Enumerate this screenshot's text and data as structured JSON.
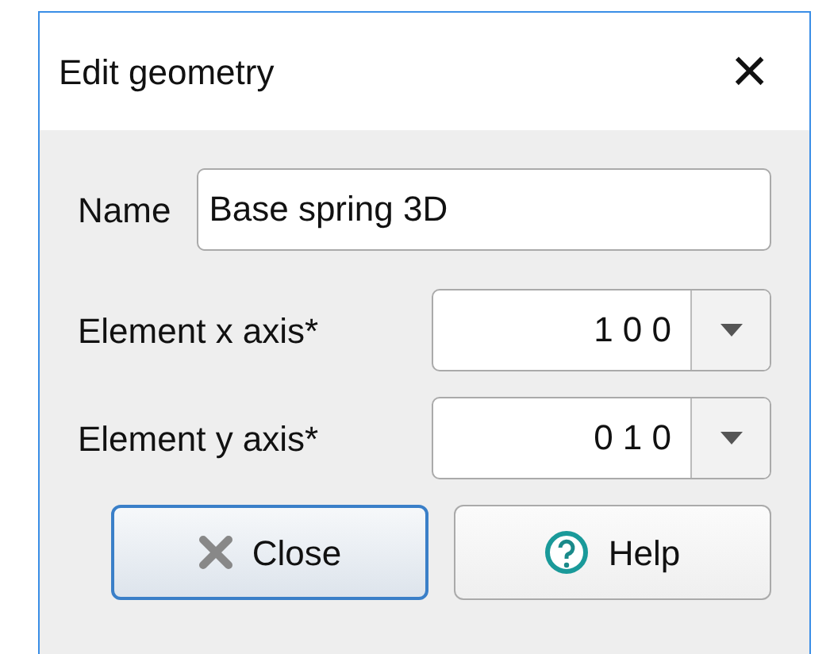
{
  "window": {
    "title": "Edit geometry",
    "close": "×"
  },
  "name_field": {
    "label": "Name",
    "value": "Base spring 3D"
  },
  "axes": [
    {
      "label": "Element x axis*",
      "value": "1 0 0"
    },
    {
      "label": "Element y axis*",
      "value": "0 1 0"
    }
  ],
  "buttons": [
    {
      "label": "Close",
      "kind": "close",
      "default": true
    },
    {
      "label": "Help",
      "kind": "help",
      "default": false
    }
  ]
}
